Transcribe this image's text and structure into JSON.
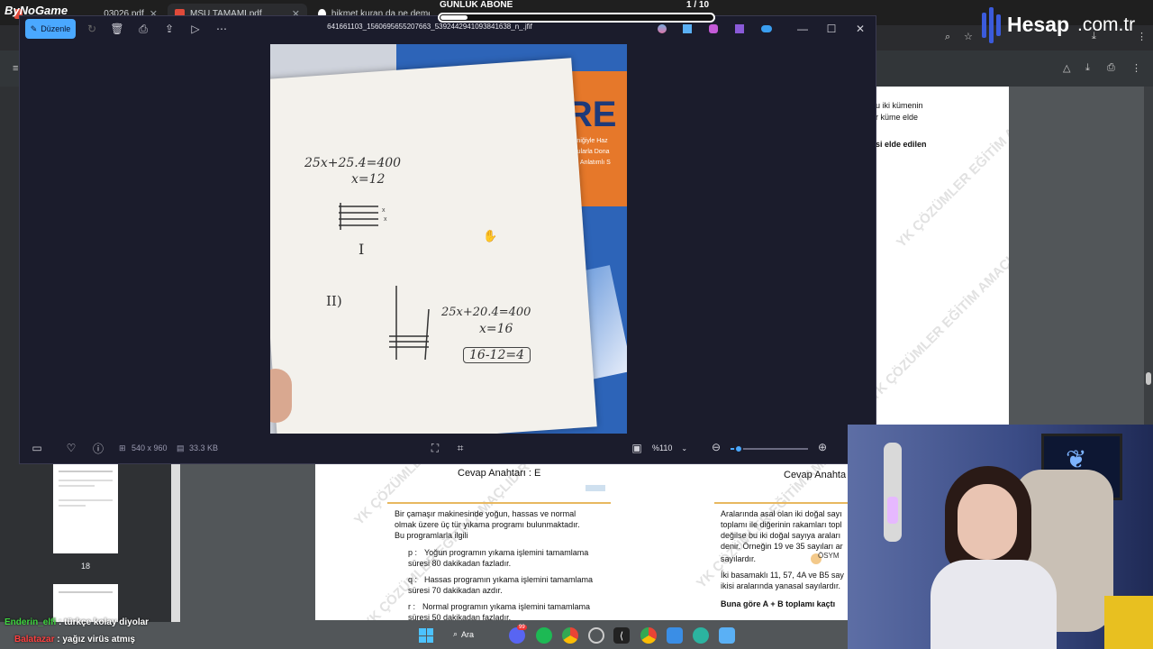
{
  "brand": "ByNoGame",
  "tabs": [
    {
      "label": "03026.pdf"
    },
    {
      "label": "MSU TAMAMI.pdf"
    },
    {
      "label": "hikmet kuran da ne demek - G"
    }
  ],
  "overlay": {
    "title": "GÜNLÜK ABONE",
    "count": "1  / 10",
    "progress": 0.1
  },
  "hesap": {
    "logo": "Hesap",
    "suffix": ".com.tr"
  },
  "viewer": {
    "edit_label": "Düzenle",
    "filename": "641661103_1560695655207663_5392442941093841638_n_.jfif",
    "dimensions": "540 x 960",
    "filesize": "33.3 KB",
    "zoom": "%110",
    "zoom_level": 0.1
  },
  "note": {
    "line1": "25x+25.4=400",
    "line2": "x=12",
    "roman1": "I",
    "roman2": "II)",
    "line3": "25x+20.4=400",
    "line4": "x=16",
    "line5": "16-12=4",
    "book_title": "ÜRE",
    "book_sub1": "ma Tekniğiyle Haz",
    "book_sub2": "ın Sorularla Dona",
    "book_sub3": "Konu Anlatımlı S"
  },
  "pdf": {
    "thumb_page": "18",
    "right_text": [
      "u iki kümenin",
      "r küme elde",
      "si elde edilen"
    ],
    "watermark": "YK ÇÖZÜMLER EĞİTİM AMAÇLIDIR YK",
    "answer1": "Cevap Anahtarı : E",
    "answer2": "Cevap Anahta",
    "q1": [
      "Bir çamaşır makinesinde yoğun, hassas ve normal",
      "olmak üzere üç tür yıkama programı bulunmaktadır.",
      "Bu programlarla ilgili"
    ],
    "p_label": "p :",
    "p_text": [
      "Yoğun programın yıkama işlemini tamamlama",
      "süresi 80 dakikadan fazladır."
    ],
    "q_label": "q :",
    "q_text": [
      "Hassas programın yıkama işlemini tamamlama",
      "süresi 70 dakikadan azdır."
    ],
    "r_label": "r :",
    "r_text": [
      "Normal programın yıkama işlemini tamamlama",
      "süresi 50 dakikadan fazladır."
    ],
    "q2": [
      "Aralarında asal olan iki doğal sayı",
      "toplamı ile diğerinin rakamları topl",
      "değilse bu iki doğal sayıya araları",
      "denir. Örneğin 19 ve 35 sayıları ar",
      "sayılardır."
    ],
    "q2b": [
      "İki basamaklı 11, 57, 4A ve B5 say",
      "ikisi aralarında yanasal sayılardır."
    ],
    "q2c": "Buna göre  A + B  toplamı kaçtı",
    "osym": "ÖSYM"
  },
  "chat": [
    {
      "user": "Enderin_elfi",
      "msg": " : türkçe kolay diyolar",
      "color": "#3fd63f"
    },
    {
      "user": "Balatazar",
      "msg": " : yağız virüs atmış",
      "color": "#ff4040"
    }
  ],
  "taskbar": {
    "search": "Ara",
    "badge": "99"
  }
}
